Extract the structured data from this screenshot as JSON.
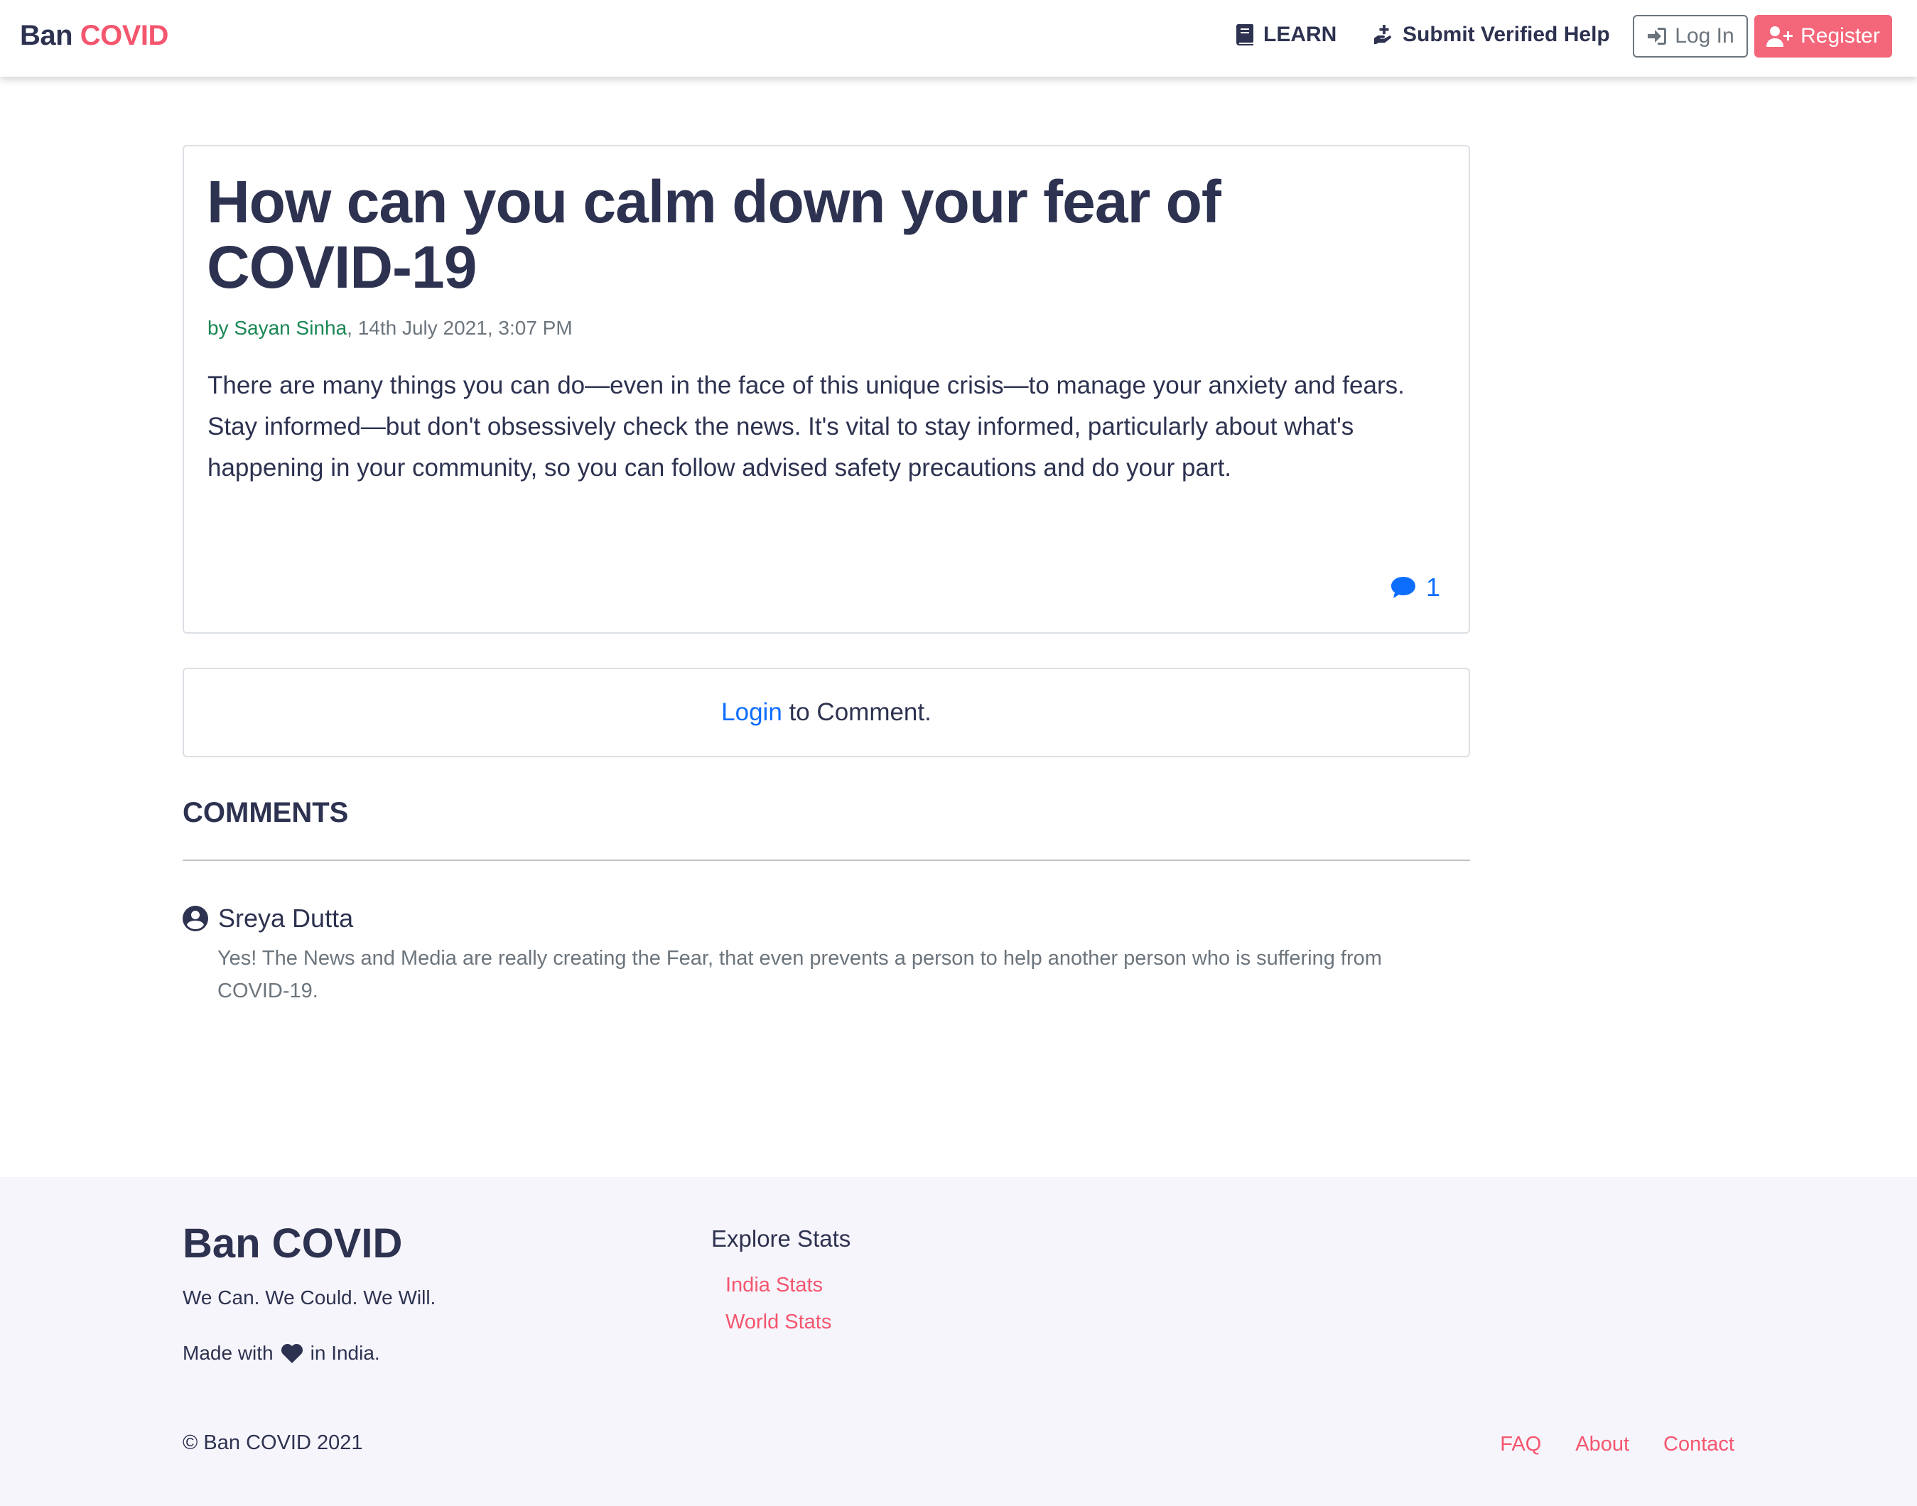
{
  "navbar": {
    "brand_part1": "Ban",
    "brand_part2": "COVID",
    "learn_label": "LEARN",
    "submit_help_label": "Submit Verified Help",
    "login_label": "Log In",
    "register_label": "Register"
  },
  "post": {
    "title": "How can you calm down your fear of COVID-19",
    "author_prefix": "by Sayan Sinha",
    "date": ", 14th July 2021, 3:07 PM",
    "body": "There are many things you can do—even in the face of this unique crisis—to manage your anxiety and fears. Stay informed—but don't obsessively check the news. It's vital to stay informed, particularly about what's happening in your community, so you can follow advised safety precautions and do your part.",
    "comment_count": "1"
  },
  "login_prompt": {
    "link_label": "Login",
    "rest": " to Comment."
  },
  "comments_section": {
    "heading": "COMMENTS",
    "items": [
      {
        "author": "Sreya Dutta",
        "text": "Yes! The News and Media are really creating the Fear, that even prevents a person to help another person who is suffering from COVID-19."
      }
    ]
  },
  "footer": {
    "brand": "Ban COVID",
    "tagline": "We Can. We Could. We Will.",
    "made_prefix": "Made with",
    "made_suffix": "in India.",
    "explore_title": "Explore Stats",
    "india_stats": "India Stats",
    "world_stats": "World Stats",
    "copyright": "© Ban COVID 2021",
    "links": {
      "faq": "FAQ",
      "about": "About",
      "contact": "Contact"
    }
  },
  "colors": {
    "brand_accent": "#f4566e",
    "text_dark": "#2d3250",
    "link_blue": "#0d6efd",
    "author_green": "#198754",
    "footer_bg": "#f7f5fc"
  },
  "icons": {
    "learn": "book-icon",
    "submit_help": "hand-holding-medical-icon",
    "login": "sign-in-icon",
    "register": "user-plus-icon",
    "comments": "comment-icon",
    "comment_author": "user-circle-icon",
    "made_with": "heart-icon"
  }
}
